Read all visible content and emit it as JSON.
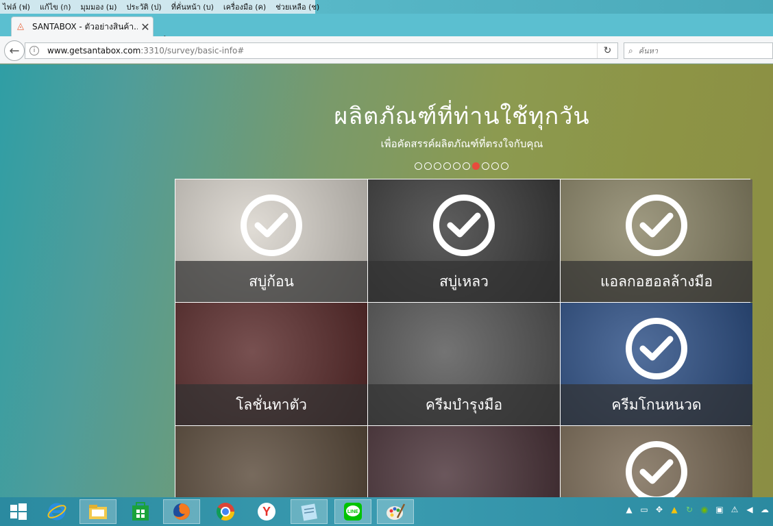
{
  "menubar": {
    "items": [
      "ไฟล์ (ฟ)",
      "แก้ไข (ก)",
      "มุมมอง (ม)",
      "ประวัติ (ป)",
      "ที่คั่นหน้า (บ)",
      "เครื่องมือ (ค)",
      "ช่วยเหลือ (ช)"
    ]
  },
  "tab": {
    "title": "SANTABOX - ตัวอย่างสินค้า..."
  },
  "navbar": {
    "url_host": "www.getsantabox.com",
    "url_path": ":3310/survey/basic-info#",
    "search_placeholder": "ค้นหา"
  },
  "page": {
    "title": "ผลิตภัณฑ์ที่ท่านใช้ทุกวัน",
    "subtitle": "เพื่อคัดสรรค์ผลิตภัณฑ์ที่ตรงใจกับคุณ",
    "dots_total": 10,
    "dots_active_index": 6
  },
  "products": [
    {
      "label": "สบู่ก้อน",
      "checked": true,
      "bg": "#d9d4cc"
    },
    {
      "label": "สบู่เหลว",
      "checked": true,
      "bg": "#3a3a3a"
    },
    {
      "label": "แอลกอฮอลล้างมือ",
      "checked": true,
      "bg": "#8a8466"
    },
    {
      "label": "โลชั่นทาตัว",
      "checked": false,
      "bg": "#5a2a2a"
    },
    {
      "label": "ครีมบำรุงมือ",
      "checked": false,
      "bg": "#555555"
    },
    {
      "label": "ครีมโกนหนวด",
      "checked": true,
      "bg": "#2c4f86"
    },
    {
      "label": "",
      "checked": false,
      "bg": "#5a4a3a"
    },
    {
      "label": "",
      "checked": false,
      "bg": "#4a3238"
    },
    {
      "label": "",
      "checked": true,
      "bg": "#7a6a55"
    }
  ],
  "taskbar": {
    "apps": [
      "start-icon",
      "internet-explorer-icon",
      "file-explorer-icon",
      "store-icon",
      "firefox-icon",
      "chrome-icon",
      "yandex-icon",
      "notepad-icon",
      "line-icon",
      "paint-icon"
    ],
    "active_app": "firefox-icon"
  }
}
